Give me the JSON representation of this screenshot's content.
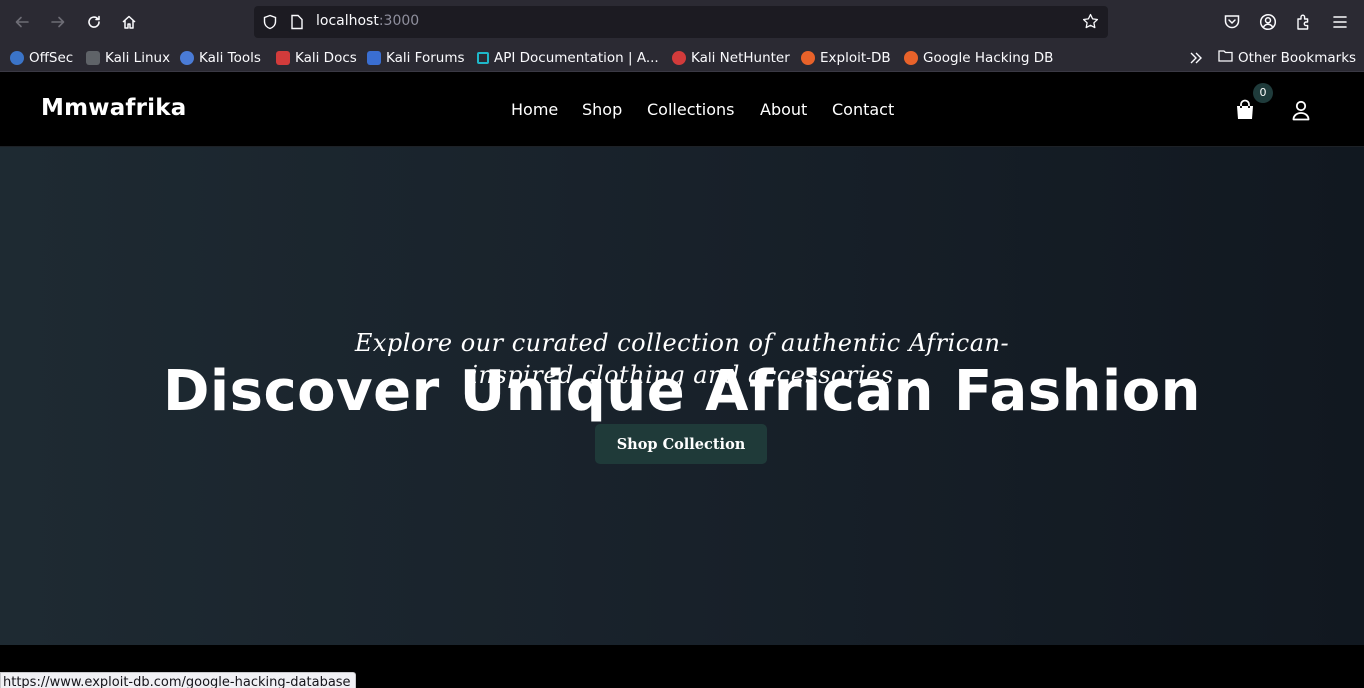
{
  "browser": {
    "url_host": "localhost",
    "url_port": ":3000",
    "bookmarks": [
      {
        "label": "OffSec",
        "icon": "offsec-icon",
        "color": "#3b74c8"
      },
      {
        "label": "Kali Linux",
        "icon": "kali-dragon-icon",
        "color": "#9aa0a6"
      },
      {
        "label": "Kali Tools",
        "icon": "kali-tools-icon",
        "color": "#4a7bd6"
      },
      {
        "label": "Kali Docs",
        "icon": "kali-docs-icon",
        "color": "#d23b3b"
      },
      {
        "label": "Kali Forums",
        "icon": "kali-forums-icon",
        "color": "#3a6ed1"
      },
      {
        "label": "API Documentation | A...",
        "icon": "api-docs-icon",
        "color": "#1fb7c9"
      },
      {
        "label": "Kali NetHunter",
        "icon": "nethunter-icon",
        "color": "#d23b3b"
      },
      {
        "label": "Exploit-DB",
        "icon": "exploit-db-icon",
        "color": "#e8622a"
      },
      {
        "label": "Google Hacking DB",
        "icon": "ghdb-icon",
        "color": "#e8622a"
      }
    ],
    "other_bookmarks": "Other Bookmarks",
    "status_url": "https://www.exploit-db.com/google-hacking-database"
  },
  "site": {
    "brand": "Mmwafrika",
    "nav": {
      "home": "Home",
      "shop": "Shop",
      "collections": "Collections",
      "about": "About",
      "contact": "Contact"
    },
    "cart_count": "0"
  },
  "hero": {
    "subtitle": "Explore our curated collection of authentic African-inspired clothing and accessories",
    "title": "Discover Unique African Fashion",
    "cta": "Shop Collection"
  },
  "colors": {
    "accent": "#1f3a39",
    "header_bg": "#000000",
    "hero_bg": "#1a242d"
  }
}
